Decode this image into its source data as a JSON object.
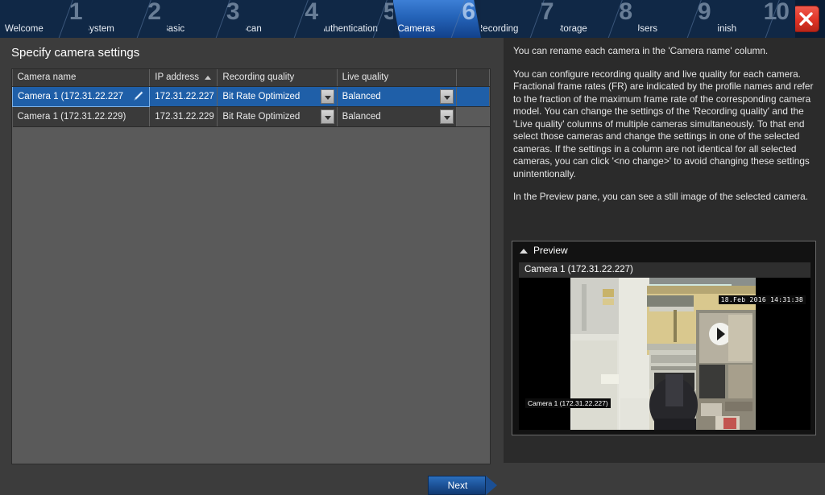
{
  "header": {
    "steps": [
      {
        "num": "1",
        "label": "Welcome",
        "active": false
      },
      {
        "num": "2",
        "label": "System",
        "active": false
      },
      {
        "num": "3",
        "label": "Basic",
        "active": false
      },
      {
        "num": "4",
        "label": "Scan",
        "active": false
      },
      {
        "num": "5",
        "label": "Authentication",
        "active": false
      },
      {
        "num": "6",
        "label": "Cameras",
        "active": true
      },
      {
        "num": "7",
        "label": "Recording",
        "active": false
      },
      {
        "num": "8",
        "label": "Storage",
        "active": false
      },
      {
        "num": "9",
        "label": "Users",
        "active": false
      },
      {
        "num": "10",
        "label": "Finish",
        "active": false
      }
    ],
    "close_icon": "close-icon"
  },
  "main": {
    "page_title": "Specify camera settings",
    "table": {
      "columns": [
        {
          "label": "Camera name",
          "sorted": false
        },
        {
          "label": "IP address",
          "sorted": true,
          "sort_dir": "asc"
        },
        {
          "label": "Recording quality",
          "sorted": false
        },
        {
          "label": "Live quality",
          "sorted": false
        },
        {
          "label": "",
          "sorted": false
        }
      ],
      "rows": [
        {
          "camera_name": "Camera 1 (172.31.22.227",
          "ip_address": "172.31.22.227",
          "recording_quality": "Bit Rate Optimized",
          "live_quality": "Balanced",
          "selected": true,
          "editing": true,
          "edit_icon": "pencil-icon"
        },
        {
          "camera_name": "Camera 1 (172.31.22.229)",
          "ip_address": "172.31.22.229",
          "recording_quality": "Bit Rate Optimized",
          "live_quality": "Balanced",
          "selected": false,
          "editing": false,
          "edit_icon": ""
        }
      ]
    },
    "next_label": "Next"
  },
  "help": {
    "paragraphs": [
      "You can rename each camera in the 'Camera name' column.",
      "You can configure recording quality and live quality for each camera. Fractional frame rates (FR) are indicated by the profile names and refer to the fraction of the maximum frame rate of the corresponding camera model. You can change the settings of the 'Recording quality' and the 'Live quality' columns of multiple cameras simultaneously. To that end select those cameras and change the settings in one of the selected cameras. If the settings in a column are not identical for all selected cameras, you can click '<no change>' to avoid changing these settings unintentionally.",
      "In the Preview pane, you can see a still image of the selected camera."
    ]
  },
  "preview": {
    "panel_title": "Preview",
    "collapse_icon": "chevron-up-icon",
    "camera_title": "Camera 1 (172.31.22.227)",
    "video_timestamp": "18.Feb 2016  14:31:38",
    "video_camera_label": "Camera 1 (172.31.22.227)"
  },
  "colors": {
    "accent_blue": "#1f5fa8",
    "header_blue": "#102846",
    "active_tab_blue": "#2463b8",
    "close_red": "#e03426",
    "body_bg": "#3c3c3c",
    "panel_bg": "#2b2b2b",
    "table_bg": "#5a5a5a"
  }
}
